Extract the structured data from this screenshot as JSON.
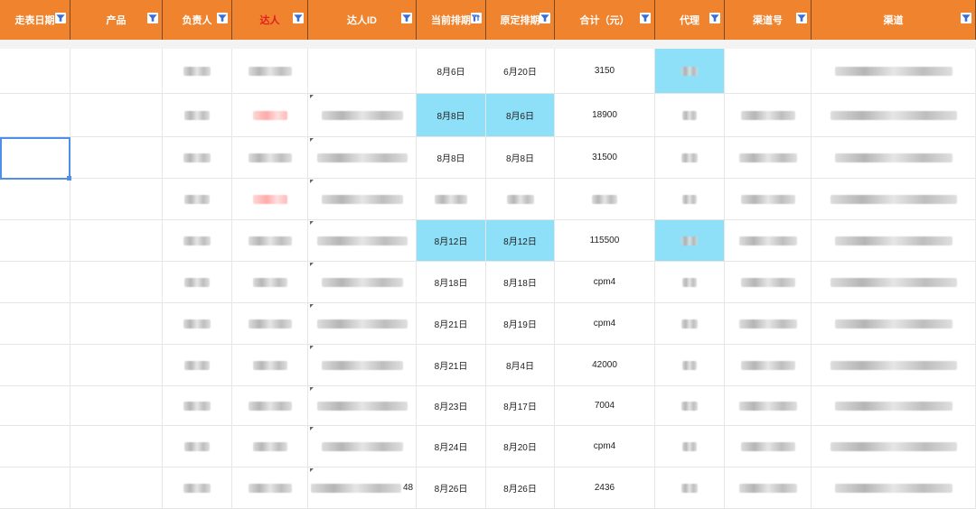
{
  "headers": [
    {
      "label": "走表日期",
      "red": false
    },
    {
      "label": "产品",
      "red": false
    },
    {
      "label": "负责人",
      "red": false
    },
    {
      "label": "达人",
      "red": true
    },
    {
      "label": "达人ID",
      "red": false
    },
    {
      "label": "当前排期",
      "red": false,
      "sorted": true
    },
    {
      "label": "原定排期",
      "red": false
    },
    {
      "label": "合计（元）",
      "red": false
    },
    {
      "label": "代理",
      "red": false
    },
    {
      "label": "渠道号",
      "red": false
    },
    {
      "label": "渠道",
      "red": false
    }
  ],
  "rows": [
    {
      "current": "8月6日",
      "original": "6月20日",
      "total": "3150",
      "idSuffix": "",
      "highlight": "agent"
    },
    {
      "current": "8月8日",
      "original": "8月6日",
      "total": "18900",
      "idSuffix": "",
      "highlight": "dates"
    },
    {
      "current": "8月8日",
      "original": "8月8日",
      "total": "31500",
      "idSuffix": "",
      "highlight": ""
    },
    {
      "current": "",
      "original": "",
      "total": "",
      "idSuffix": "",
      "highlight": ""
    },
    {
      "current": "8月12日",
      "original": "8月12日",
      "total": "115500",
      "idSuffix": "",
      "highlight": "both"
    },
    {
      "current": "8月18日",
      "original": "8月18日",
      "total": "cpm4",
      "idSuffix": "",
      "highlight": ""
    },
    {
      "current": "8月21日",
      "original": "8月19日",
      "total": "cpm4",
      "idSuffix": "",
      "highlight": ""
    },
    {
      "current": "8月21日",
      "original": "8月4日",
      "total": "42000",
      "idSuffix": "",
      "highlight": ""
    },
    {
      "current": "8月23日",
      "original": "8月17日",
      "total": "7004",
      "idSuffix": "",
      "highlight": ""
    },
    {
      "current": "8月24日",
      "original": "8月20日",
      "total": "cpm4",
      "idSuffix": "",
      "highlight": ""
    },
    {
      "current": "8月26日",
      "original": "8月26日",
      "total": "2436",
      "idSuffix": "48",
      "highlight": ""
    }
  ],
  "colors": {
    "header": "#f0832e",
    "highlight": "#8edff8",
    "selection": "#4f8fe8",
    "redText": "#e02020"
  }
}
